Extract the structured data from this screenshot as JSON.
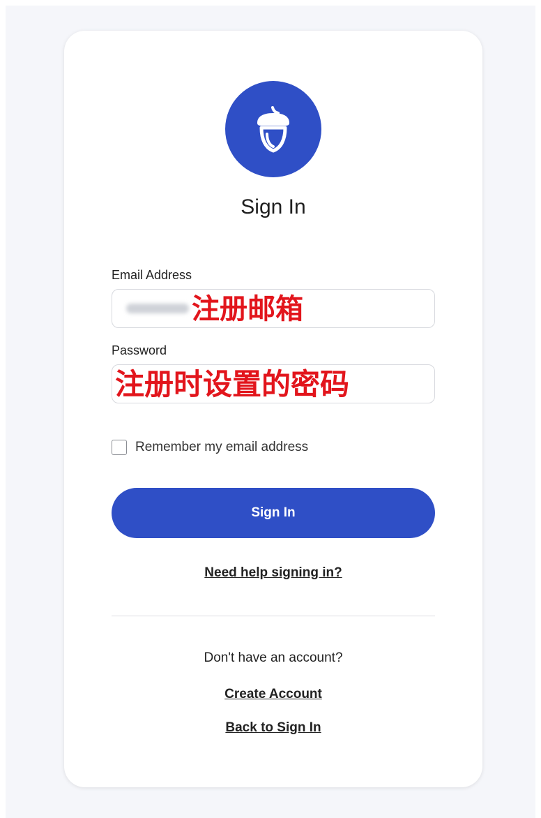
{
  "brand": {
    "primary_color": "#2f4fc6"
  },
  "logo": {
    "icon": "acorn-icon"
  },
  "form": {
    "title": "Sign In",
    "email_label": "Email Address",
    "email_overlay": "注册邮箱",
    "password_label": "Password",
    "password_overlay": "注册时设置的密码",
    "remember_label": "Remember my email address",
    "remember_checked": false,
    "submit_label": "Sign In",
    "help_link": "Need help signing in?"
  },
  "footer": {
    "no_account_text": "Don't have an account?",
    "create_account_link": "Create Account",
    "back_link": "Back to Sign In"
  }
}
